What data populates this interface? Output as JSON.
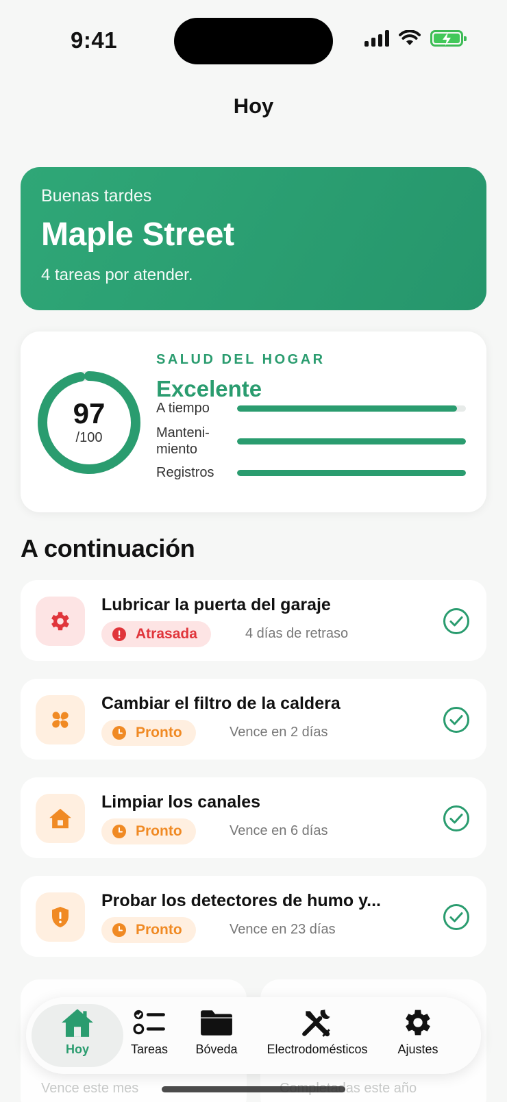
{
  "status_bar": {
    "time": "9:41"
  },
  "nav": {
    "title": "Hoy"
  },
  "hero": {
    "greeting": "Buenas tardes",
    "title": "Maple Street",
    "subtitle": "4 tareas por atender."
  },
  "health": {
    "eyebrow": "SALUD DEL HOGAR",
    "status": "Excelente",
    "score": "97",
    "max": "/100",
    "score_fraction": 0.97,
    "metrics": [
      {
        "label": "A tiempo",
        "value": 0.96
      },
      {
        "label": "Manteni-\nmiento",
        "value": 1.0
      },
      {
        "label": "Registros",
        "value": 1.0
      }
    ]
  },
  "section": {
    "title": "A continuación"
  },
  "tasks": [
    {
      "title": "Lubricar la puerta del garaje",
      "badge": "Atrasada",
      "due": "4 días de retraso",
      "icon": "gear-icon",
      "state": "overdue"
    },
    {
      "title": "Cambiar el filtro de la caldera",
      "badge": "Pronto",
      "due": "Vence en 2 días",
      "icon": "fan-icon",
      "state": "soon"
    },
    {
      "title": "Limpiar los canales",
      "badge": "Pronto",
      "due": "Vence en 6 días",
      "icon": "house-icon",
      "state": "soon"
    },
    {
      "title": "Probar los detectores de humo y...",
      "badge": "Pronto",
      "due": "Vence en 23 días",
      "icon": "shield-alert-icon",
      "state": "soon"
    }
  ],
  "bottom_cards": {
    "left_caption": "Vence este mes",
    "right_caption": "Completadas este año"
  },
  "tabbar": {
    "items": [
      {
        "label": "Hoy",
        "icon": "house-icon",
        "active": true
      },
      {
        "label": "Tareas",
        "icon": "checklist-icon",
        "active": false
      },
      {
        "label": "Bóveda",
        "icon": "folder-icon",
        "active": false
      },
      {
        "label": "Electrodomésticos",
        "icon": "tools-icon",
        "active": false
      },
      {
        "label": "Ajustes",
        "icon": "gear-icon",
        "active": false
      }
    ]
  },
  "colors": {
    "accent": "#2a9c6f",
    "overdue": "#e0353b",
    "soon": "#f08a24"
  }
}
